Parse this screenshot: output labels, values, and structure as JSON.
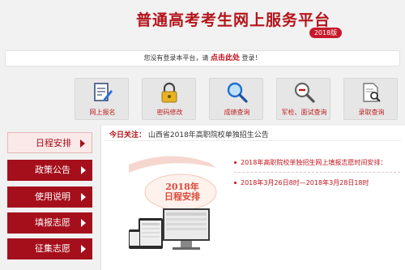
{
  "header": {
    "title": "普通高考考生网上服务平台",
    "year_badge": "2018版"
  },
  "login_bar": {
    "prefix": "您没有登录本平台，请",
    "link": "点击此处",
    "suffix": "登录！"
  },
  "quick_nav": [
    {
      "label": "网上报名",
      "icon": "form-pen-icon"
    },
    {
      "label": "密码修改",
      "icon": "lock-icon"
    },
    {
      "label": "成绩查询",
      "icon": "magnifier-icon"
    },
    {
      "label": "军检、面试查询",
      "icon": "zoom-out-icon"
    },
    {
      "label": "录取查询",
      "icon": "document-search-icon"
    }
  ],
  "sidebar": [
    {
      "label": "日程安排",
      "active": true
    },
    {
      "label": "政策公告",
      "active": false
    },
    {
      "label": "使用说明",
      "active": false
    },
    {
      "label": "填报志愿",
      "active": false
    },
    {
      "label": "征集志愿",
      "active": false
    }
  ],
  "main": {
    "notice_label": "今日关注：",
    "notice_text": "山西省2018年高职院校单独招生公告",
    "illustration_title_line1": "2018年",
    "illustration_title_line2": "日程安排",
    "schedule": [
      {
        "text": "2018年高职院校单独招生网上填报志愿时间安排："
      },
      {
        "text": "2018年3月26日8时—2018年3月28日18时"
      }
    ]
  },
  "colors": {
    "brand_red": "#b4141b",
    "sidebar_red": "#a50f1b",
    "link_red": "#c4121c"
  }
}
